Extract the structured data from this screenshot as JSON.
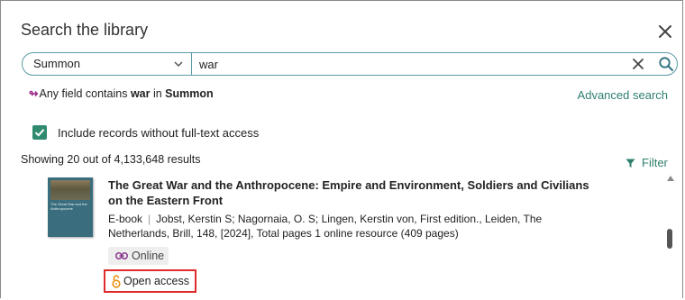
{
  "dialog": {
    "title": "Search the library",
    "close_icon": "close-icon"
  },
  "search": {
    "scope_value": "Summon",
    "query_value": "war",
    "clear_icon": "clear-icon",
    "search_icon": "search-icon"
  },
  "query_summary": {
    "prefix": "Any field contains ",
    "term": "war",
    "middle": " in ",
    "scope": "Summon"
  },
  "advanced_search_label": "Advanced search",
  "fulltext_filter": {
    "checked": true,
    "label": "Include records without full-text access"
  },
  "results_summary": "Showing 20 out of 4,133,648 results",
  "filter_label": "Filter",
  "result": {
    "cover_title": "The Great War and the Anthropocene",
    "title_line1": "The Great War and the Anthropocene: Empire and Environment, Soldiers and Civilians",
    "title_line2": "on the Eastern Front",
    "type": "E-book",
    "separator": "|",
    "meta": "Jobst, Kerstin S; Nagornaia, O. S; Lingen, Kerstin von, First edition., Leiden, The Netherlands, Brill, 148, [2024], Total pages 1 online resource (409 pages)",
    "online_label": "Online",
    "open_access_label": "Open access"
  },
  "colors": {
    "accent": "#2f7f6f",
    "checkbox": "#2f8a70",
    "highlight_border": "#e02b2b",
    "open_access_icon": "#e6900f",
    "query_arrow": "#9b2d8a"
  }
}
